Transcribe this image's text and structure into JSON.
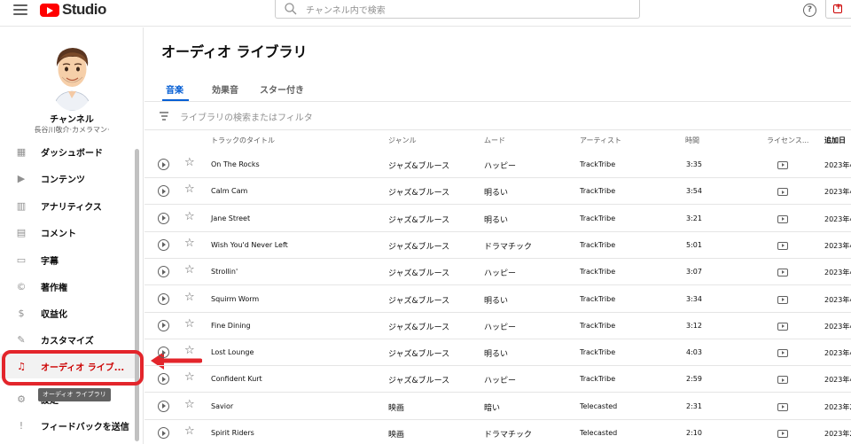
{
  "header": {
    "logo_text": "Studio",
    "search_placeholder": "チャンネル内で検索",
    "help_glyph": "?"
  },
  "sidebar": {
    "channel_name": "チャンネル",
    "channel_sub": "長谷川敬介·カメラマン·",
    "items": [
      {
        "label": "ダッシュボード",
        "icon": "dashboard-icon",
        "glyph": "▦"
      },
      {
        "label": "コンテンツ",
        "icon": "content-icon",
        "glyph": "▶"
      },
      {
        "label": "アナリティクス",
        "icon": "analytics-icon",
        "glyph": "▥"
      },
      {
        "label": "コメント",
        "icon": "comment-icon",
        "glyph": "▤"
      },
      {
        "label": "字幕",
        "icon": "subtitles-icon",
        "glyph": "▭"
      },
      {
        "label": "著作権",
        "icon": "copyright-icon",
        "glyph": "©"
      },
      {
        "label": "収益化",
        "icon": "monetization-icon",
        "glyph": "$"
      },
      {
        "label": "カスタマイズ",
        "icon": "customize-icon",
        "glyph": "✎"
      },
      {
        "label": "オーディオ ライブ...",
        "icon": "audio-library-icon",
        "glyph": "♫"
      },
      {
        "label": "設定",
        "icon": "settings-icon",
        "glyph": "⚙"
      },
      {
        "label": "フィードバックを送信",
        "icon": "feedback-icon",
        "glyph": "!"
      }
    ],
    "tooltip": "オーディオ ライブラリ"
  },
  "main": {
    "title": "オーディオ ライブラリ",
    "tabs": [
      "音楽",
      "効果音",
      "スター付き"
    ],
    "filter_placeholder": "ライブラリの検索またはフィルタ",
    "columns": [
      "トラックのタイトル",
      "ジャンル",
      "ムード",
      "アーティスト",
      "時間",
      "ライセンス...",
      "追加日"
    ],
    "rows": [
      {
        "title": "On The Rocks",
        "genre": "ジャズ&ブルース",
        "mood": "ハッピー",
        "artist": "TrackTribe",
        "duration": "3:35",
        "date": "2023年4"
      },
      {
        "title": "Calm Cam",
        "genre": "ジャズ&ブルース",
        "mood": "明るい",
        "artist": "TrackTribe",
        "duration": "3:54",
        "date": "2023年4"
      },
      {
        "title": "Jane Street",
        "genre": "ジャズ&ブルース",
        "mood": "明るい",
        "artist": "TrackTribe",
        "duration": "3:21",
        "date": "2023年4"
      },
      {
        "title": "Wish You'd Never Left",
        "genre": "ジャズ&ブルース",
        "mood": "ドラマチック",
        "artist": "TrackTribe",
        "duration": "5:01",
        "date": "2023年4"
      },
      {
        "title": "Strollin'",
        "genre": "ジャズ&ブルース",
        "mood": "ハッピー",
        "artist": "TrackTribe",
        "duration": "3:07",
        "date": "2023年4"
      },
      {
        "title": "Squirm Worm",
        "genre": "ジャズ&ブルース",
        "mood": "明るい",
        "artist": "TrackTribe",
        "duration": "3:34",
        "date": "2023年4"
      },
      {
        "title": "Fine Dining",
        "genre": "ジャズ&ブルース",
        "mood": "ハッピー",
        "artist": "TrackTribe",
        "duration": "3:12",
        "date": "2023年4"
      },
      {
        "title": "Lost Lounge",
        "genre": "ジャズ&ブルース",
        "mood": "明るい",
        "artist": "TrackTribe",
        "duration": "4:03",
        "date": "2023年4"
      },
      {
        "title": "Confident Kurt",
        "genre": "ジャズ&ブルース",
        "mood": "ハッピー",
        "artist": "TrackTribe",
        "duration": "2:59",
        "date": "2023年4"
      },
      {
        "title": "Savior",
        "genre": "映画",
        "mood": "暗い",
        "artist": "Telecasted",
        "duration": "2:31",
        "date": "2023年2"
      },
      {
        "title": "Spirit Riders",
        "genre": "映画",
        "mood": "ドラマチック",
        "artist": "Telecasted",
        "duration": "2:10",
        "date": "2023年2"
      }
    ]
  },
  "colors": {
    "accent": "#065fd4",
    "brand": "#ff0000",
    "highlight": "#e3252b"
  }
}
